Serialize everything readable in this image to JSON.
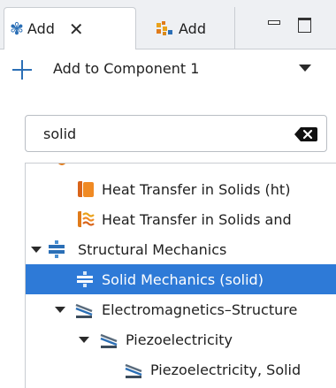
{
  "tabs": [
    {
      "label": "Add",
      "icon": "physics-icon",
      "closable": true,
      "active": true
    },
    {
      "label": "Add",
      "icon": "multiphysics-icon",
      "active": false
    }
  ],
  "add_target": {
    "label": "Add to Component 1",
    "icon": "plus-icon"
  },
  "search": {
    "value": "solid",
    "clear_icon": "clear-icon"
  },
  "tree": {
    "items": [
      {
        "label": "Heat Transfer in Solids (ht)",
        "icon": "heat-transfer-icon"
      },
      {
        "label": "Heat Transfer in Solids and",
        "icon": "heat-transfer-fluids-icon"
      },
      {
        "label": "Structural Mechanics",
        "icon": "structural-mechanics-icon",
        "expanded": true
      },
      {
        "label": "Solid Mechanics (solid)",
        "icon": "solid-mechanics-icon",
        "selected": true
      },
      {
        "label": "Electromagnetics–Structure",
        "icon": "electromagnetics-structure-icon",
        "expanded": true
      },
      {
        "label": "Piezoelectricity",
        "icon": "piezoelectricity-icon",
        "expanded": true
      },
      {
        "label": "Piezoelectricity, Solid",
        "icon": "piezoelectricity-icon"
      }
    ]
  },
  "colors": {
    "selection": "#2e7ad7",
    "accent": "#2b6fb6",
    "heat": "#e07b1a"
  }
}
